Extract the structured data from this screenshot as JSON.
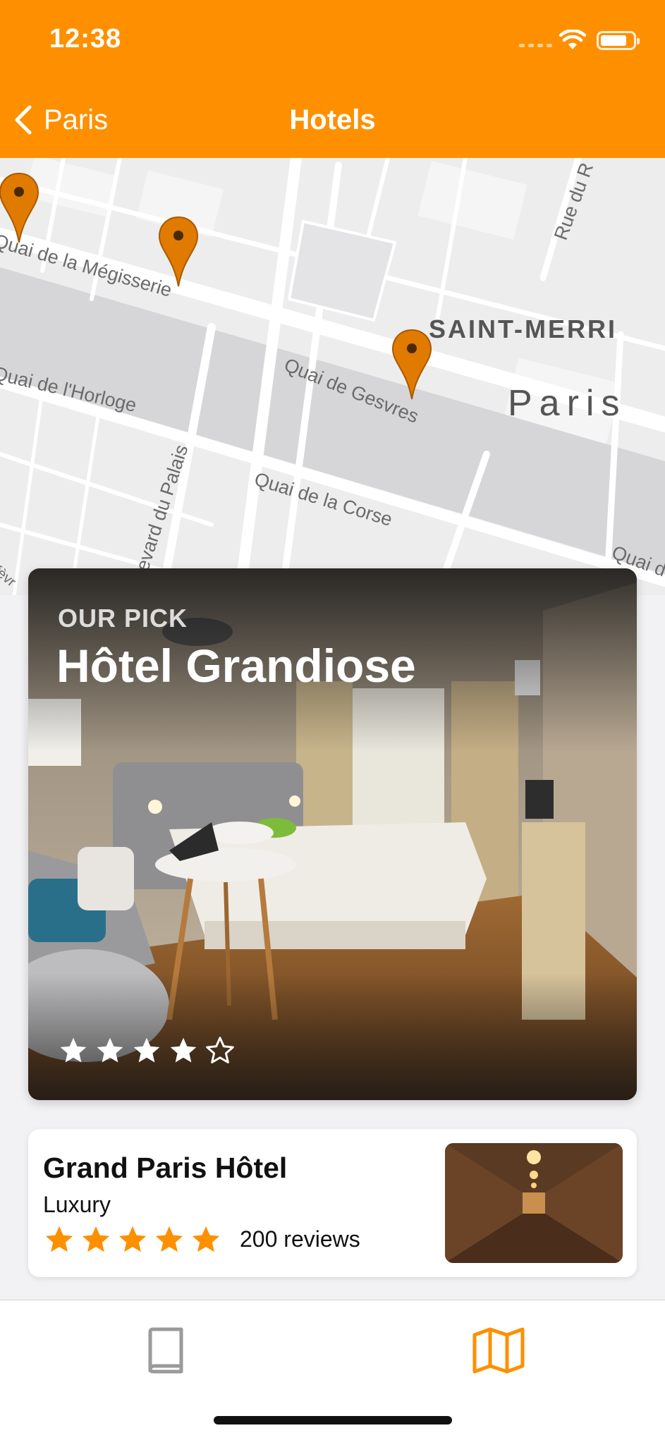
{
  "status_bar": {
    "time": "12:38"
  },
  "nav": {
    "back_label": "Paris",
    "title": "Hotels"
  },
  "map": {
    "streets": {
      "quai_megisserie": "Quai de la Mégisserie",
      "quai_gesvres": "Quai de Gesvres",
      "quai_horloge": "Quai de l'Horloge",
      "quai_corse": "Quai de la Corse",
      "boulevard_palais": "ulevard du Palais",
      "rue_du_r": "Rue du R",
      "quai_right": "Quai d",
      "orfevres": "rfèvr"
    },
    "districts": {
      "saint_merri": "SAINT-MERRI",
      "paris": "Paris"
    },
    "pin_color": "#e07b00"
  },
  "featured": {
    "eyebrow": "OUR PICK",
    "name": "Hôtel Grandiose",
    "rating": 4,
    "max_rating": 5
  },
  "hotels": [
    {
      "name": "Grand Paris Hôtel",
      "category": "Luxury",
      "rating": 5,
      "reviews": "200 reviews"
    }
  ],
  "tabs": [
    {
      "icon": "book-icon",
      "active": false
    },
    {
      "icon": "map-icon",
      "active": true
    }
  ],
  "colors": {
    "accent": "#fe9000",
    "tab_inactive": "#9a9a9a",
    "star": "#fe9000"
  }
}
